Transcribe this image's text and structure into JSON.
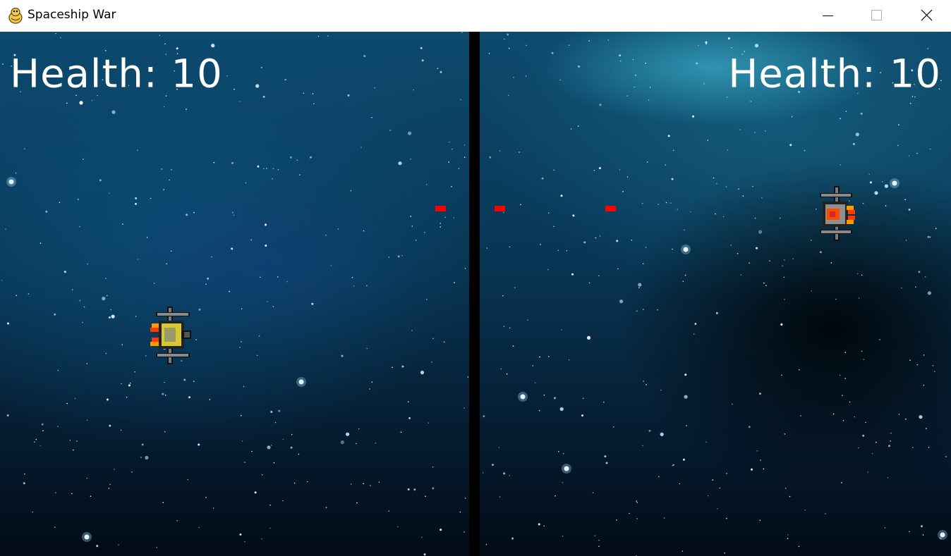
{
  "window": {
    "title": "Spaceship War",
    "app_icon": "pygame-snake-icon",
    "controls": [
      "minimize-icon",
      "maximize-icon",
      "close-icon"
    ]
  },
  "hud": {
    "yellow_health": "Health: 10",
    "red_health": "Health: 10"
  },
  "colors": {
    "bullet": "#ff0000",
    "border": "#000000",
    "text": "#ffffff"
  },
  "entities": {
    "yellow_ship": "spaceship-yellow-facing-right",
    "red_ship": "spaceship-red-facing-left",
    "bullets": 3
  }
}
